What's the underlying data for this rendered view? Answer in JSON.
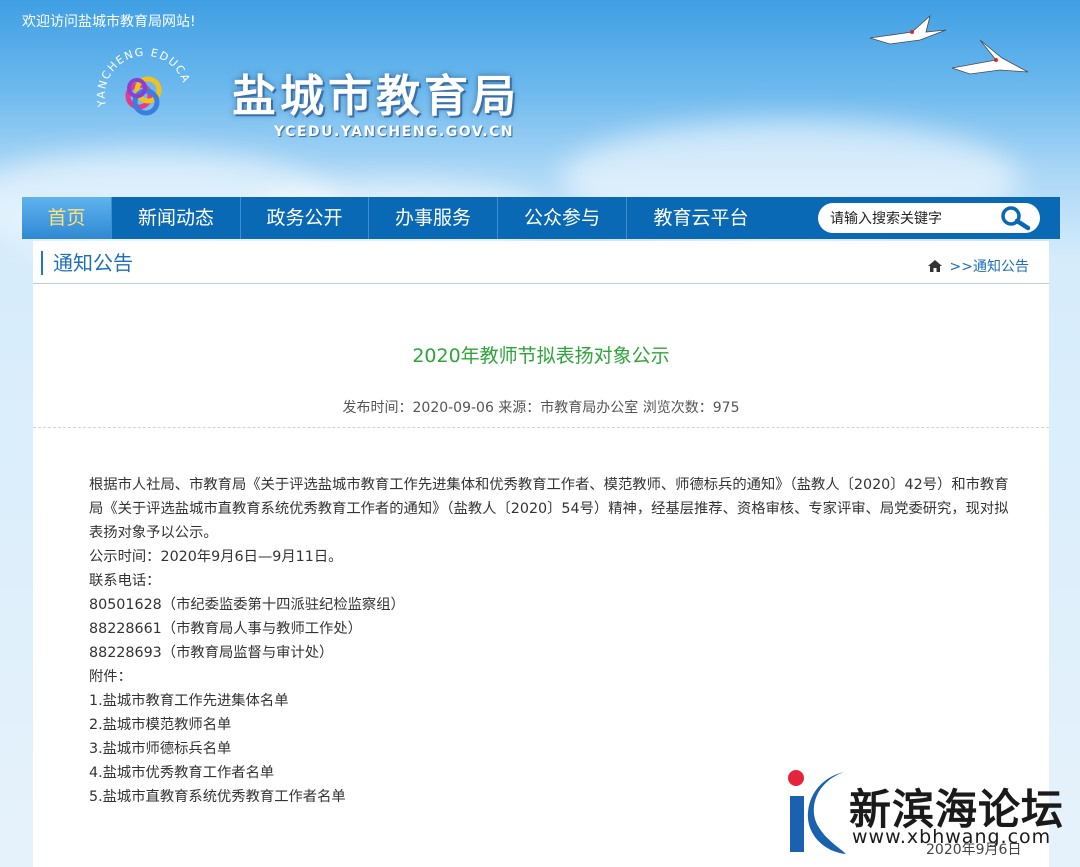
{
  "header": {
    "welcome": "欢迎访问盐城市教育局网站!",
    "site_title": "盐城市教育局",
    "site_domain": "YCEDU.YANCHENG.GOV.CN",
    "logo_ring_text": "YANCHENG EDUCATION CHINA"
  },
  "nav": {
    "items": [
      {
        "label": "首页"
      },
      {
        "label": "新闻动态"
      },
      {
        "label": "政务公开"
      },
      {
        "label": "办事服务"
      },
      {
        "label": "公众参与"
      },
      {
        "label": "教育云平台"
      }
    ],
    "search_placeholder": "请输入搜索关键字"
  },
  "section": {
    "title": "通知公告",
    "breadcrumb_sep": ">>",
    "breadcrumb_current": "通知公告"
  },
  "article": {
    "title": "2020年教师节拟表扬对象公示",
    "meta": "发布时间：2020-09-06 来源：市教育局办公室 浏览次数：975",
    "intro": "根据市人社局、市教育局《关于评选盐城市教育工作先进集体和优秀教育工作者、模范教师、师德标兵的通知》（盐教人〔2020〕42号）和市教育局《关于评选盐城市直教育系统优秀教育工作者的通知》（盐教人〔2020〕54号）精神，经基层推荐、资格审核、专家评审、局党委研究，现对拟表扬对象予以公示。",
    "period": "公示时间：2020年9月6日—9月11日。",
    "phone_label": "联系电话：",
    "phones": [
      "80501628（市纪委监委第十四派驻纪检监察组）",
      "88228661（市教育局人事与教师工作处）",
      "88228693（市教育局监督与审计处）"
    ],
    "attachments_label": "附件：",
    "attachments": [
      "1.盐城市教育工作先进集体名单",
      "2.盐城市模范教师名单",
      "3.盐城市师德标兵名单",
      "4.盐城市优秀教育工作者名单",
      "5.盐城市直教育系统优秀教育工作者名单"
    ]
  },
  "watermark": {
    "name": "新滨海论坛",
    "url": "www.xbhwang.com",
    "date": "2020年9月6日"
  },
  "colors": {
    "nav_bg": "#0a69b5",
    "nav_active": "#2f88d2",
    "title_green": "#2ea53a",
    "link_blue": "#1e6fba"
  }
}
